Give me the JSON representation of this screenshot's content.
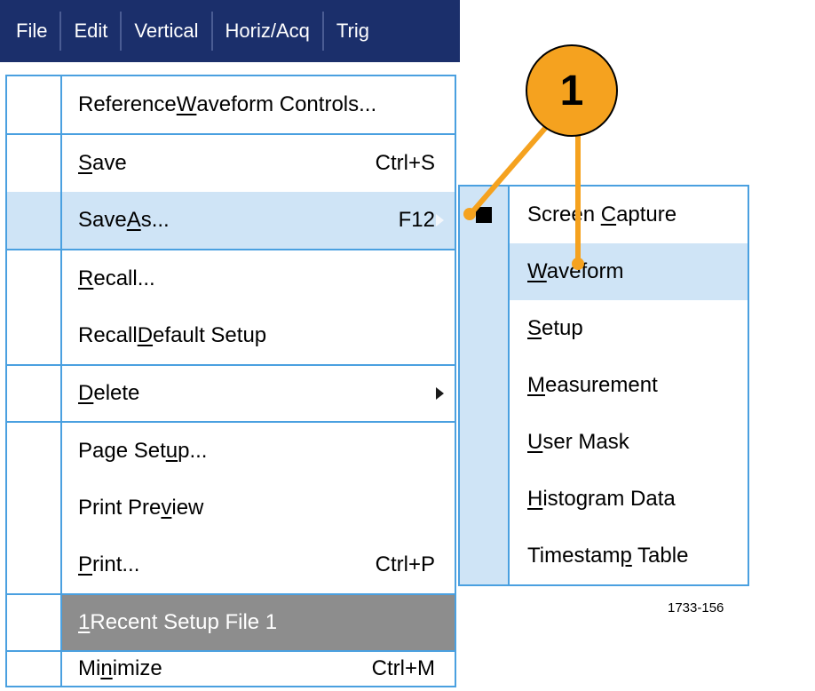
{
  "menubar": {
    "items": [
      "File",
      "Edit",
      "Vertical",
      "Horiz/Acq",
      "Trig"
    ]
  },
  "file_menu": {
    "ref_waveform": {
      "pre": "Reference ",
      "mn": "W",
      "post": "aveform Controls..."
    },
    "save": {
      "pre": "",
      "mn": "S",
      "post": "ave",
      "shortcut": "Ctrl+S"
    },
    "save_as": {
      "pre": "Save ",
      "mn": "A",
      "post": "s...",
      "shortcut": "F12"
    },
    "recall": {
      "pre": "",
      "mn": "R",
      "post": "ecall..."
    },
    "recall_def": {
      "pre": "Recall ",
      "mn": "D",
      "post": "efault Setup"
    },
    "delete": {
      "pre": "",
      "mn": "D",
      "post": "elete"
    },
    "page_setup": {
      "pre": "Page Set",
      "mn": "u",
      "post": "p..."
    },
    "preview": {
      "pre": "Print Pre",
      "mn": "v",
      "post": "iew"
    },
    "print": {
      "pre": "",
      "mn": "P",
      "post": "rint...",
      "shortcut": "Ctrl+P"
    },
    "recent": {
      "pre": "",
      "mn": "1",
      "post": " Recent Setup File 1"
    },
    "minimize": {
      "pre": "Mi",
      "mn": "n",
      "post": "imize",
      "shortcut": "Ctrl+M"
    }
  },
  "save_as_submenu": {
    "screen_capture": {
      "pre": "Screen ",
      "mn": "C",
      "post": "apture"
    },
    "waveform": {
      "pre": "",
      "mn": "W",
      "post": "aveform"
    },
    "setup": {
      "pre": "",
      "mn": "S",
      "post": "etup"
    },
    "measurement": {
      "pre": "",
      "mn": "M",
      "post": "easurement"
    },
    "user_mask": {
      "pre": "",
      "mn": "U",
      "post": "ser Mask"
    },
    "histogram": {
      "pre": "",
      "mn": "H",
      "post": "istogram Data"
    },
    "timestamp": {
      "pre": "Timestam",
      "mn": "p",
      "post": " Table"
    }
  },
  "callout": {
    "number": "1"
  },
  "figure_id": "1733-156"
}
